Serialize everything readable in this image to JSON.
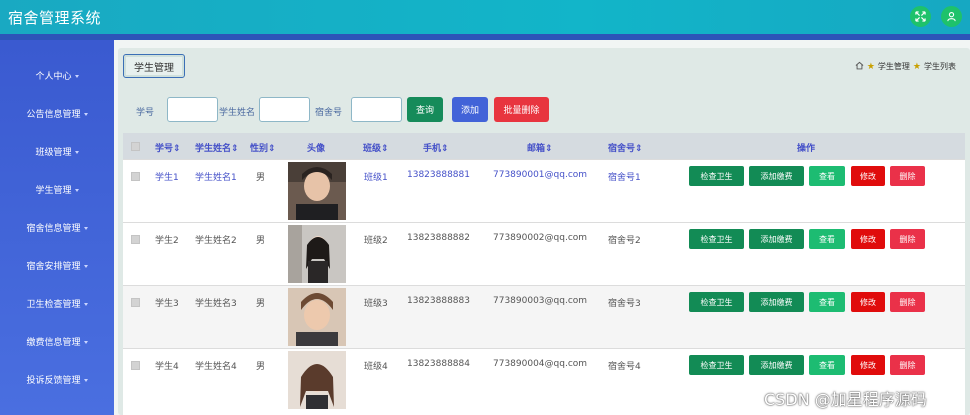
{
  "app": {
    "title": "宿舍管理系统"
  },
  "topbar": {
    "icons": [
      "expand-icon",
      "user-icon"
    ],
    "accent": "#1ec26b"
  },
  "sidebar": {
    "items": [
      {
        "label": "个人中心"
      },
      {
        "label": "公告信息管理"
      },
      {
        "label": "班级管理"
      },
      {
        "label": "学生管理"
      },
      {
        "label": "宿舍信息管理"
      },
      {
        "label": "宿舍安排管理"
      },
      {
        "label": "卫生检查管理"
      },
      {
        "label": "缴费信息管理"
      },
      {
        "label": "投诉反馈管理"
      }
    ]
  },
  "page": {
    "title": "学生管理",
    "breadcrumb": [
      "学生管理",
      "学生列表"
    ]
  },
  "filters": {
    "student_id_label": "学号",
    "student_name_label": "学生姓名",
    "dorm_no_label": "宿舍号",
    "query_button": "查询",
    "add_button": "添加",
    "batch_delete_button": "批量删除"
  },
  "table": {
    "columns": [
      "学号",
      "学生姓名",
      "性别",
      "头像",
      "班级",
      "手机",
      "邮箱",
      "宿舍号",
      "操作"
    ],
    "rows": [
      {
        "id": "学生1",
        "name": "学生姓名1",
        "gender": "男",
        "class": "班级1",
        "phone": "13823888881",
        "email": "773890001@qq.com",
        "dorm": "宿舍号1"
      },
      {
        "id": "学生2",
        "name": "学生姓名2",
        "gender": "男",
        "class": "班级2",
        "phone": "13823888882",
        "email": "773890002@qq.com",
        "dorm": "宿舍号2"
      },
      {
        "id": "学生3",
        "name": "学生姓名3",
        "gender": "男",
        "class": "班级3",
        "phone": "13823888883",
        "email": "773890003@qq.com",
        "dorm": "宿舍号3"
      },
      {
        "id": "学生4",
        "name": "学生姓名4",
        "gender": "男",
        "class": "班级4",
        "phone": "13823888884",
        "email": "773890004@qq.com",
        "dorm": "宿舍号4"
      }
    ],
    "actions": {
      "check": "检查卫生",
      "pay": "添加缴费",
      "view": "查看",
      "edit": "修改",
      "delete": "删除"
    }
  },
  "watermark": "CSDN @加星程序源码"
}
